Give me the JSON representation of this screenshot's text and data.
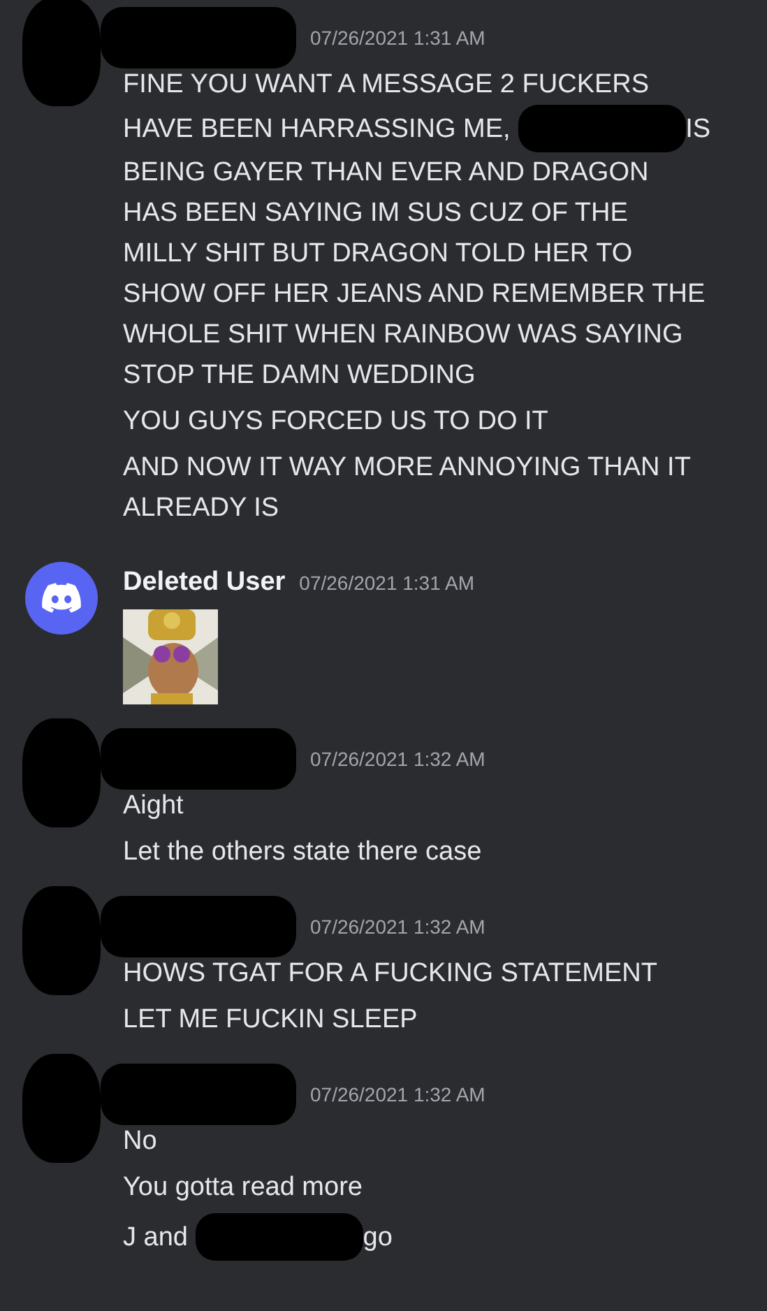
{
  "messages": [
    {
      "avatar": {
        "kind": "redacted"
      },
      "author": {
        "kind": "redacted"
      },
      "timestamp": "07/26/2021 1:31 AM",
      "paragraphs": [
        [
          [
            {
              "kind": "text",
              "text": "FINE YOU WANT A MESSAGE 2 FUCKERS"
            }
          ],
          [
            {
              "kind": "text",
              "text": "HAVE BEEN HARRASSING ME, "
            },
            {
              "kind": "redaction"
            },
            {
              "kind": "text",
              "text": "IS"
            }
          ],
          [
            {
              "kind": "text",
              "text": "BEING GAYER THAN EVER AND DRAGON"
            }
          ],
          [
            {
              "kind": "text",
              "text": "HAS BEEN SAYING IM SUS CUZ OF THE"
            }
          ],
          [
            {
              "kind": "text",
              "text": "MILLY SHIT BUT DRAGON TOLD HER TO"
            }
          ],
          [
            {
              "kind": "text",
              "text": "SHOW OFF HER JEANS AND REMEMBER THE"
            }
          ],
          [
            {
              "kind": "text",
              "text": "WHOLE SHIT WHEN RAINBOW WAS SAYING"
            }
          ],
          [
            {
              "kind": "text",
              "text": "STOP THE DAMN WEDDING"
            }
          ]
        ],
        [
          [
            {
              "kind": "text",
              "text": "YOU GUYS FORCED US TO DO IT"
            }
          ]
        ],
        [
          [
            {
              "kind": "text",
              "text": "AND NOW IT WAY MORE ANNOYING THAN IT"
            }
          ],
          [
            {
              "kind": "text",
              "text": "ALREADY IS"
            }
          ]
        ]
      ]
    },
    {
      "avatar": {
        "kind": "discord"
      },
      "author": {
        "kind": "name",
        "text": "Deleted User"
      },
      "timestamp": "07/26/2021 1:31 AM"
    },
    {
      "avatar": {
        "kind": "redacted"
      },
      "author": {
        "kind": "redacted"
      },
      "timestamp": "07/26/2021 1:32 AM",
      "paragraphs": [
        [
          [
            {
              "kind": "text",
              "text": "Aight"
            }
          ]
        ],
        [
          [
            {
              "kind": "text",
              "text": "Let the others state there case"
            }
          ]
        ]
      ]
    },
    {
      "avatar": {
        "kind": "redacted"
      },
      "author": {
        "kind": "redacted"
      },
      "timestamp": "07/26/2021 1:32 AM",
      "paragraphs": [
        [
          [
            {
              "kind": "text",
              "text": "HOWS TGAT FOR A FUCKING STATEMENT"
            }
          ]
        ],
        [
          [
            {
              "kind": "text",
              "text": "LET ME FUCKIN SLEEP"
            }
          ]
        ]
      ]
    },
    {
      "avatar": {
        "kind": "redacted"
      },
      "author": {
        "kind": "redacted"
      },
      "timestamp": "07/26/2021 1:32 AM",
      "paragraphs": [
        [
          [
            {
              "kind": "text",
              "text": "No"
            }
          ]
        ],
        [
          [
            {
              "kind": "text",
              "text": "You gotta read more"
            }
          ]
        ],
        [
          [
            {
              "kind": "text",
              "text": "J and "
            },
            {
              "kind": "redaction"
            },
            {
              "kind": "text",
              "text": "go"
            }
          ]
        ]
      ]
    }
  ]
}
